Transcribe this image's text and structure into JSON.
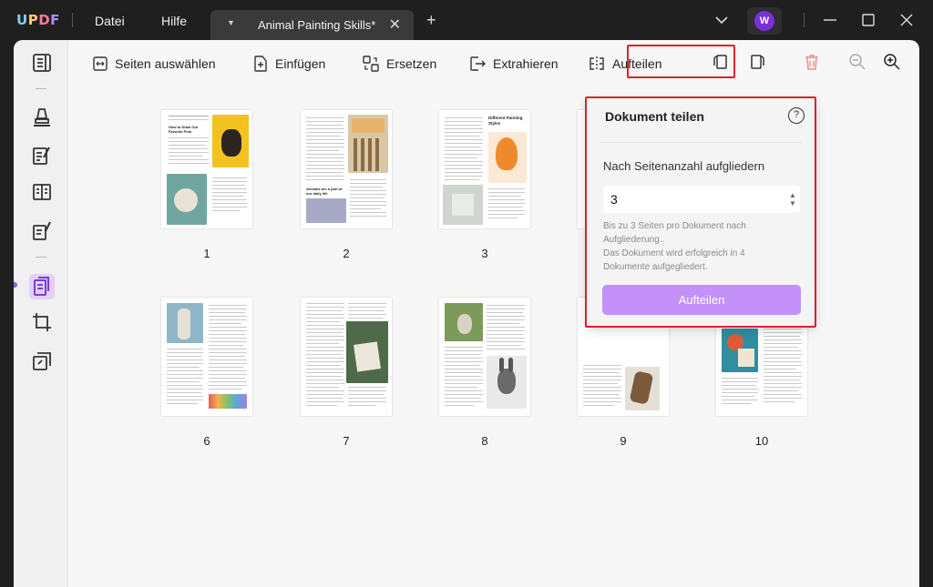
{
  "app": {
    "logo_parts": [
      "U",
      "P",
      "D",
      "F"
    ]
  },
  "menu": {
    "file": "Datei",
    "help": "Hilfe"
  },
  "tab": {
    "name": "Animal Painting Skills*",
    "close": "✕"
  },
  "avatar": {
    "initial": "W",
    "color": "#7b2fd6"
  },
  "toolbar": {
    "select_pages": "Seiten auswählen",
    "insert": "Einfügen",
    "replace": "Ersetzen",
    "extract": "Extrahieren",
    "split": "Aufteilen"
  },
  "pages": [
    {
      "number": "1",
      "heading": "How to Draw Our Favorite Pets"
    },
    {
      "number": "2",
      "heading": "Animals are a part of our daily life"
    },
    {
      "number": "3",
      "heading": "Different Painting Styles"
    },
    {
      "number": "6"
    },
    {
      "number": "7"
    },
    {
      "number": "8"
    },
    {
      "number": "9"
    },
    {
      "number": "10"
    }
  ],
  "split_panel": {
    "title": "Dokument teilen",
    "help": "?",
    "mode_label": "Nach Seitenanzahl aufgliedern",
    "value": "3",
    "hint_lines": [
      "Bis zu 3 Seiten pro Dokument nach",
      "Aufgliederung.",
      "Das Dokument wird erfolgreich in 4",
      "Dokumente aufgegliedert."
    ],
    "button": "Aufteilen",
    "button_color": "#c391f7"
  },
  "colors": {
    "highlight": "#e0202a",
    "accent": "#8f5ae6"
  }
}
